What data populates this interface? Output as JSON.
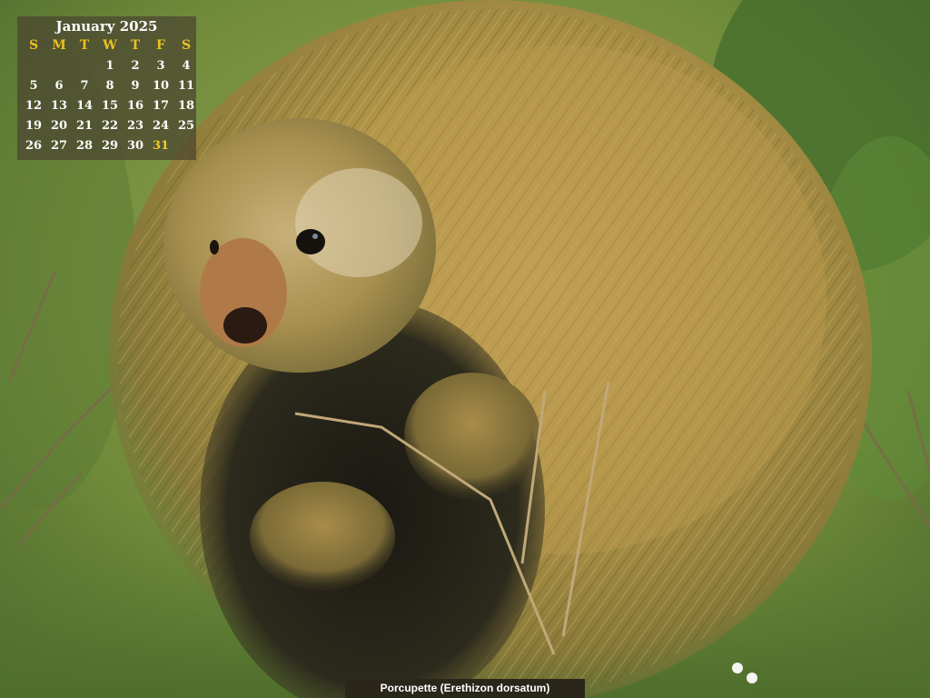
{
  "calendar": {
    "title": "January 2025",
    "weekdays": [
      "S",
      "M",
      "T",
      "W",
      "T",
      "F",
      "S"
    ],
    "weeks": [
      [
        "",
        "",
        "",
        "1",
        "2",
        "3",
        "4"
      ],
      [
        "5",
        "6",
        "7",
        "8",
        "9",
        "10",
        "11"
      ],
      [
        "12",
        "13",
        "14",
        "15",
        "16",
        "17",
        "18"
      ],
      [
        "19",
        "20",
        "21",
        "22",
        "23",
        "24",
        "25"
      ],
      [
        "26",
        "27",
        "28",
        "29",
        "30",
        "31",
        ""
      ]
    ],
    "today": "31",
    "colors": {
      "weekday_header": "#e8c020",
      "today": "#f0d020",
      "text": "#ffffff"
    }
  },
  "caption": {
    "text": "Porcupette (Erethizon dorsatum)"
  },
  "wallpaper": {
    "subject": "porcupine-photo"
  }
}
